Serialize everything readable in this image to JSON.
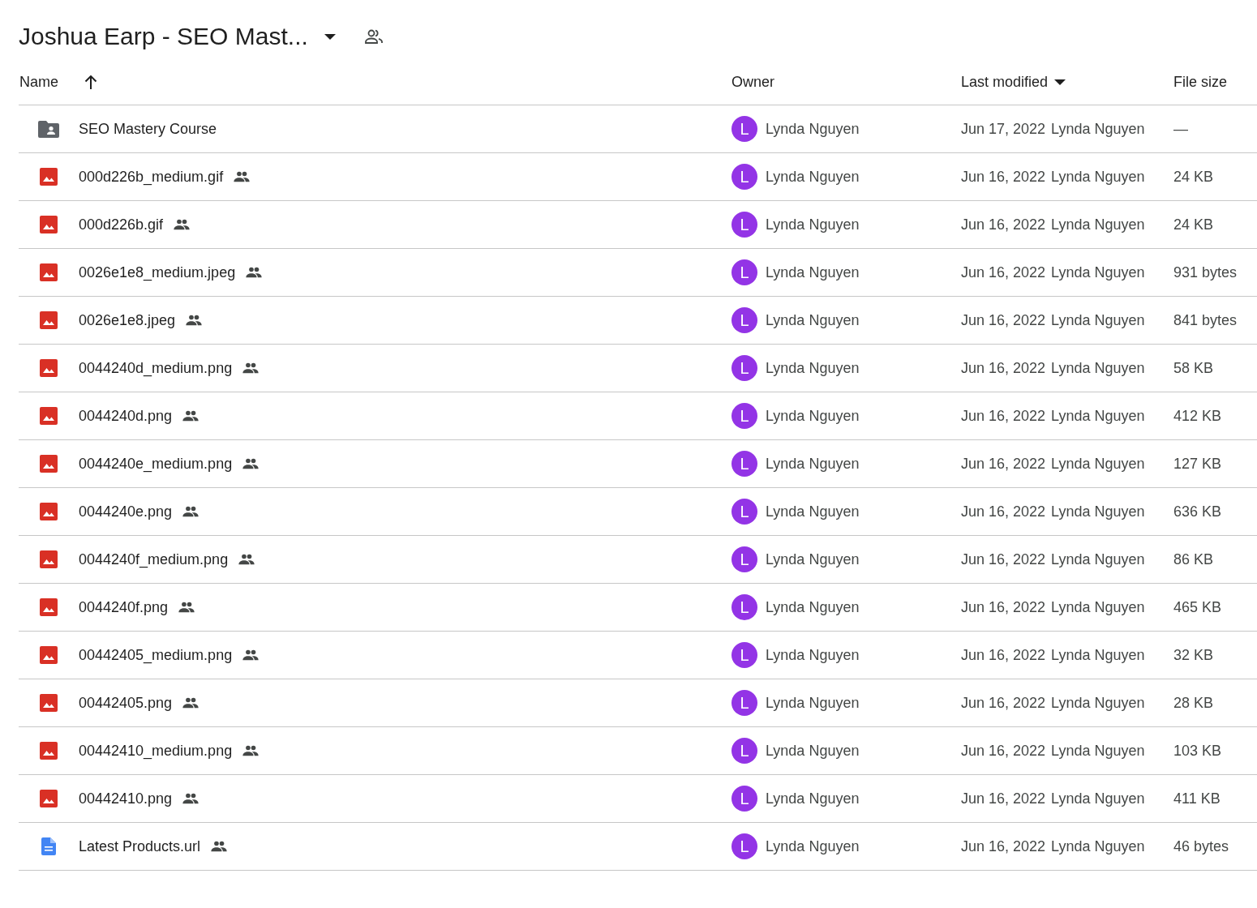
{
  "header": {
    "title": "Joshua Earp - SEO Mast..."
  },
  "table": {
    "columns": [
      {
        "label": "Name",
        "sorted_ascending": true,
        "dropdown": false
      },
      {
        "label": "Owner",
        "sorted_ascending": false,
        "dropdown": false
      },
      {
        "label": "Last modified",
        "sorted_ascending": false,
        "dropdown": true
      },
      {
        "label": "File size",
        "sorted_ascending": false,
        "dropdown": false
      }
    ],
    "rows": [
      {
        "kind": "folder",
        "name": "SEO Mastery Course",
        "shared": false,
        "owner_initial": "L",
        "owner": "Lynda Nguyen",
        "modified": "Jun 17, 2022",
        "modified_by": "Lynda Nguyen",
        "size": "—"
      },
      {
        "kind": "image",
        "name": "000d226b_medium.gif",
        "shared": true,
        "owner_initial": "L",
        "owner": "Lynda Nguyen",
        "modified": "Jun 16, 2022",
        "modified_by": "Lynda Nguyen",
        "size": "24 KB"
      },
      {
        "kind": "image",
        "name": "000d226b.gif",
        "shared": true,
        "owner_initial": "L",
        "owner": "Lynda Nguyen",
        "modified": "Jun 16, 2022",
        "modified_by": "Lynda Nguyen",
        "size": "24 KB"
      },
      {
        "kind": "image",
        "name": "0026e1e8_medium.jpeg",
        "shared": true,
        "owner_initial": "L",
        "owner": "Lynda Nguyen",
        "modified": "Jun 16, 2022",
        "modified_by": "Lynda Nguyen",
        "size": "931 bytes"
      },
      {
        "kind": "image",
        "name": "0026e1e8.jpeg",
        "shared": true,
        "owner_initial": "L",
        "owner": "Lynda Nguyen",
        "modified": "Jun 16, 2022",
        "modified_by": "Lynda Nguyen",
        "size": "841 bytes"
      },
      {
        "kind": "image",
        "name": "0044240d_medium.png",
        "shared": true,
        "owner_initial": "L",
        "owner": "Lynda Nguyen",
        "modified": "Jun 16, 2022",
        "modified_by": "Lynda Nguyen",
        "size": "58 KB"
      },
      {
        "kind": "image",
        "name": "0044240d.png",
        "shared": true,
        "owner_initial": "L",
        "owner": "Lynda Nguyen",
        "modified": "Jun 16, 2022",
        "modified_by": "Lynda Nguyen",
        "size": "412 KB"
      },
      {
        "kind": "image",
        "name": "0044240e_medium.png",
        "shared": true,
        "owner_initial": "L",
        "owner": "Lynda Nguyen",
        "modified": "Jun 16, 2022",
        "modified_by": "Lynda Nguyen",
        "size": "127 KB"
      },
      {
        "kind": "image",
        "name": "0044240e.png",
        "shared": true,
        "owner_initial": "L",
        "owner": "Lynda Nguyen",
        "modified": "Jun 16, 2022",
        "modified_by": "Lynda Nguyen",
        "size": "636 KB"
      },
      {
        "kind": "image",
        "name": "0044240f_medium.png",
        "shared": true,
        "owner_initial": "L",
        "owner": "Lynda Nguyen",
        "modified": "Jun 16, 2022",
        "modified_by": "Lynda Nguyen",
        "size": "86 KB"
      },
      {
        "kind": "image",
        "name": "0044240f.png",
        "shared": true,
        "owner_initial": "L",
        "owner": "Lynda Nguyen",
        "modified": "Jun 16, 2022",
        "modified_by": "Lynda Nguyen",
        "size": "465 KB"
      },
      {
        "kind": "image",
        "name": "00442405_medium.png",
        "shared": true,
        "owner_initial": "L",
        "owner": "Lynda Nguyen",
        "modified": "Jun 16, 2022",
        "modified_by": "Lynda Nguyen",
        "size": "32 KB"
      },
      {
        "kind": "image",
        "name": "00442405.png",
        "shared": true,
        "owner_initial": "L",
        "owner": "Lynda Nguyen",
        "modified": "Jun 16, 2022",
        "modified_by": "Lynda Nguyen",
        "size": "28 KB"
      },
      {
        "kind": "image",
        "name": "00442410_medium.png",
        "shared": true,
        "owner_initial": "L",
        "owner": "Lynda Nguyen",
        "modified": "Jun 16, 2022",
        "modified_by": "Lynda Nguyen",
        "size": "103 KB"
      },
      {
        "kind": "image",
        "name": "00442410.png",
        "shared": true,
        "owner_initial": "L",
        "owner": "Lynda Nguyen",
        "modified": "Jun 16, 2022",
        "modified_by": "Lynda Nguyen",
        "size": "411 KB"
      },
      {
        "kind": "document",
        "name": "Latest Products.url",
        "shared": true,
        "owner_initial": "L",
        "owner": "Lynda Nguyen",
        "modified": "Jun 16, 2022",
        "modified_by": "Lynda Nguyen",
        "size": "46 bytes"
      }
    ]
  }
}
